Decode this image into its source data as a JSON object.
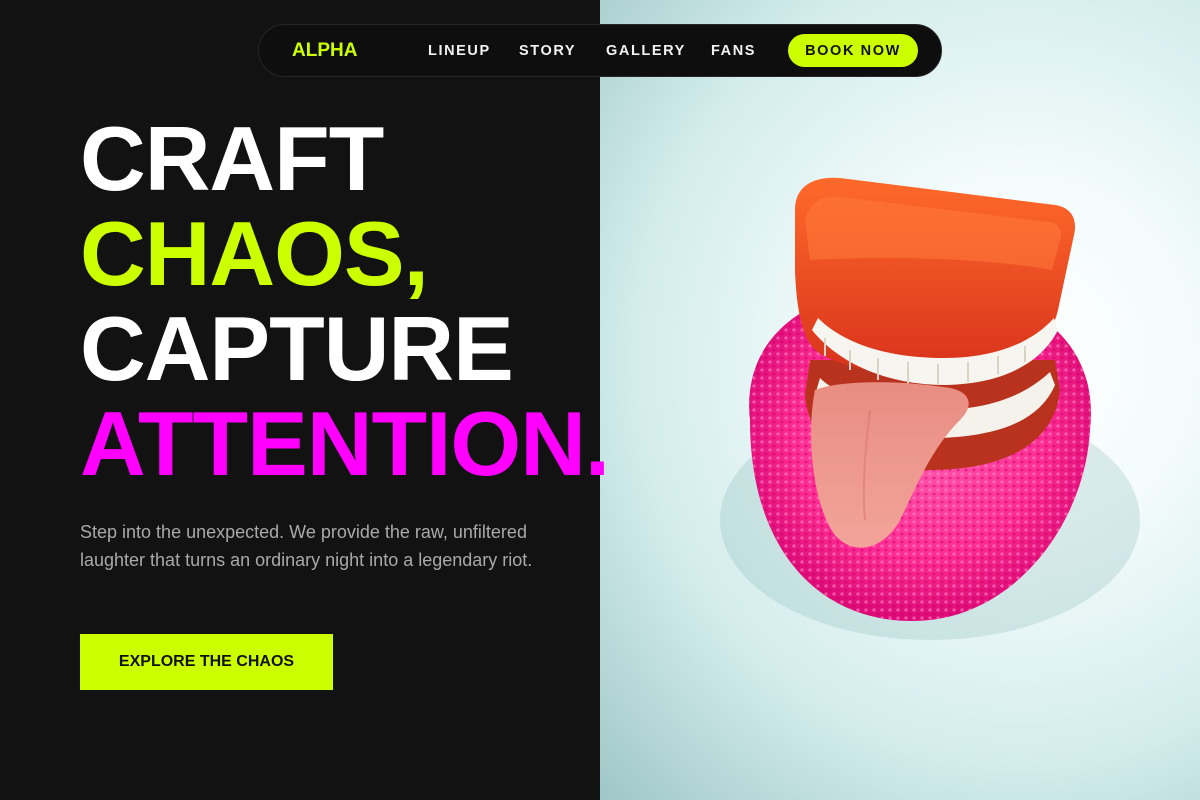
{
  "nav": {
    "brand": "ALPHA",
    "links": [
      "LINEUP",
      "STORY",
      "GALLERY",
      "FANS"
    ],
    "cta": "BOOK NOW"
  },
  "hero": {
    "lines": [
      "CRAFT",
      "CHAOS,",
      "CAPTURE",
      "ATTENTION."
    ],
    "description": "Step into the unexpected. We provide the raw, unfiltered laughter that turns an ordinary night into a legendary riot.",
    "cta": "EXPLORE THE CHAOS"
  },
  "image": {
    "subject": "wind-up chattering teeth toy with tongue on pink sponge",
    "watermark": "unsplash-style-watermark"
  },
  "colors": {
    "background": "#121212",
    "accent_lime": "#ccff00",
    "accent_magenta": "#ff00ff",
    "text_white": "#ffffff",
    "text_muted": "#a9a9a9"
  }
}
